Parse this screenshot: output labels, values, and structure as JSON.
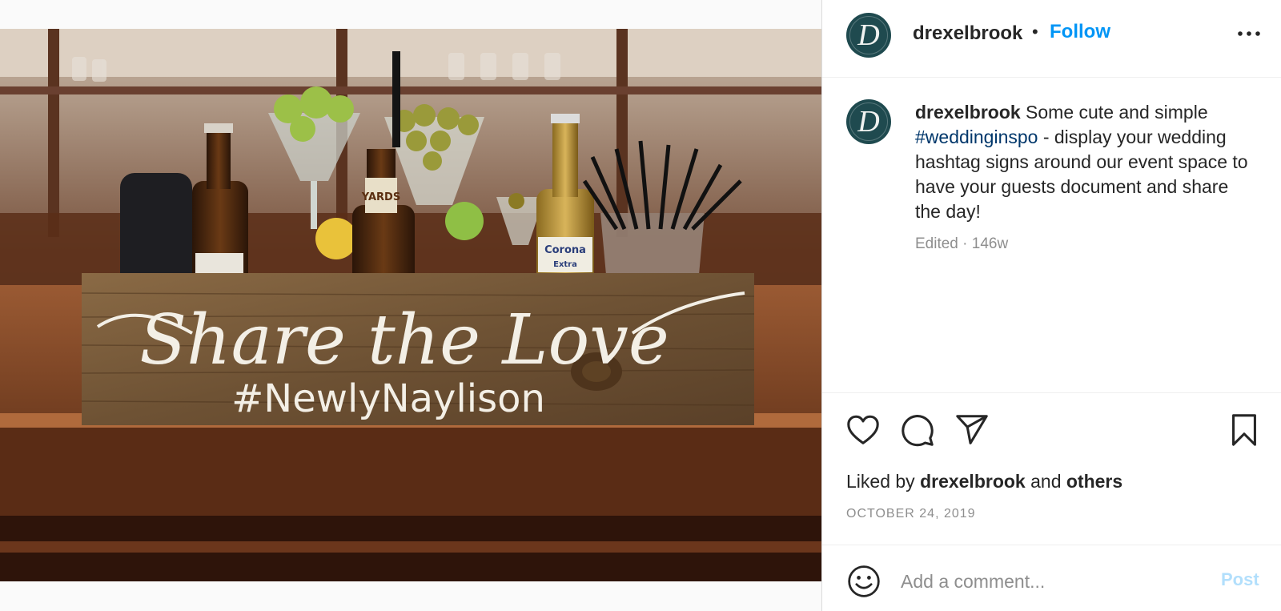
{
  "post": {
    "username": "drexelbrook",
    "avatar_letter": "D",
    "separator": "•",
    "follow_label": "Follow",
    "more_icon": "more-horizontal-icon",
    "photo": {
      "sign_script": "Share the Love",
      "sign_hashtag": "#NewlyNaylison",
      "bottle_labels": [
        "YARDS",
        "Corona",
        "Extra"
      ]
    },
    "caption": {
      "username": "drexelbrook",
      "text_before": " Some cute and simple ",
      "hashtag": "#weddinginspo",
      "text_after": " - display your wedding hashtag signs around our event space to have your guests document and share the day!"
    },
    "meta": "Edited · 146w",
    "likes": {
      "prefix": "Liked by ",
      "user": "drexelbrook",
      "middle": " and ",
      "others": "others"
    },
    "date": "OCTOBER 24, 2019",
    "comment": {
      "placeholder": "Add a comment...",
      "post_label": "Post"
    }
  },
  "colors": {
    "follow": "#0095f6",
    "hashtag": "#00376b",
    "muted": "#8e8e8e",
    "post_disabled": "#b2dffc",
    "avatar_bg": "#1f4a4f"
  }
}
